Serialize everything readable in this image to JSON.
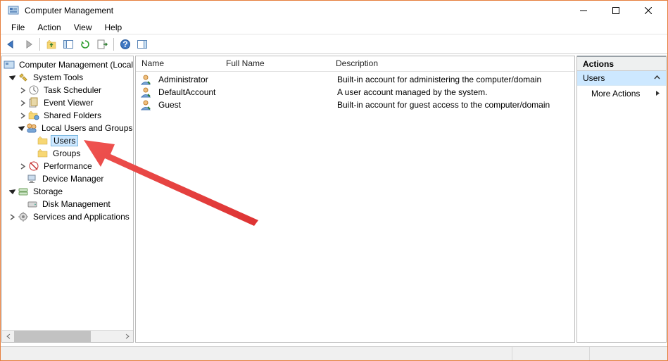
{
  "window": {
    "title": "Computer Management"
  },
  "menu": {
    "file": "File",
    "action": "Action",
    "view": "View",
    "help": "Help"
  },
  "tree": {
    "root": "Computer Management (Local)",
    "system_tools": "System Tools",
    "task_scheduler": "Task Scheduler",
    "event_viewer": "Event Viewer",
    "shared_folders": "Shared Folders",
    "local_users_groups": "Local Users and Groups",
    "users": "Users",
    "groups": "Groups",
    "performance": "Performance",
    "device_manager": "Device Manager",
    "storage": "Storage",
    "disk_management": "Disk Management",
    "services_apps": "Services and Applications"
  },
  "list": {
    "columns": {
      "name": "Name",
      "fullname": "Full Name",
      "description": "Description"
    },
    "rows": [
      {
        "name": "Administrator",
        "fullname": "",
        "description": "Built-in account for administering the computer/domain"
      },
      {
        "name": "DefaultAccount",
        "fullname": "",
        "description": "A user account managed by the system."
      },
      {
        "name": "Guest",
        "fullname": "",
        "description": "Built-in account for guest access to the computer/domain"
      }
    ]
  },
  "actions": {
    "header": "Actions",
    "context": "Users",
    "more": "More Actions"
  }
}
